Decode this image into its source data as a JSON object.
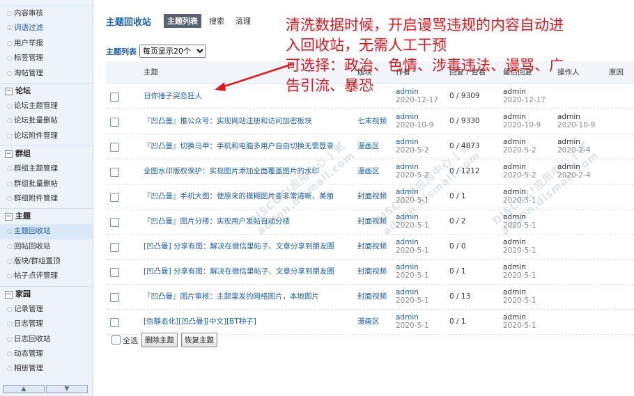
{
  "sidebar": {
    "items_top": [
      {
        "label": "内容审核"
      },
      {
        "label": "词语过滤"
      },
      {
        "label": "用户举报"
      },
      {
        "label": "标签管理"
      },
      {
        "label": "淘帖管理"
      }
    ],
    "groups": [
      {
        "title": "论坛",
        "items": [
          "论坛主题管理",
          "论坛批量删帖",
          "论坛附件管理"
        ]
      },
      {
        "title": "群组",
        "items": [
          "群组主题管理",
          "群组批量删帖",
          "群组附件管理"
        ]
      },
      {
        "title": "主题",
        "items": [
          "主题回收站",
          "回帖回收站",
          "版块/群组置顶",
          "帖子点评管理"
        ]
      },
      {
        "title": "家园",
        "items": [
          "记录管理",
          "日志管理",
          "日志回收站",
          "动态管理",
          "相册管理"
        ]
      }
    ],
    "scroll_up": "▲",
    "scroll_down": "▼"
  },
  "header": {
    "title": "主题回收站",
    "tabs": [
      "主题列表",
      "搜索",
      "清理"
    ]
  },
  "filter": {
    "label": "主题列表",
    "per_page": "每页显示20个"
  },
  "table": {
    "columns": [
      "主题",
      "版块",
      "作者",
      "回复 / 查看",
      "最后回复",
      "操作人",
      "原因"
    ],
    "rows": [
      {
        "subject": "日你捶子突恋狂人",
        "forum": "",
        "author": "admin",
        "author_date": "2020-12-17",
        "replies": "0 / 9309",
        "last": "admin",
        "last_date": "2020-12-17",
        "op": "",
        "op_date": ""
      },
      {
        "subject": "『凹凸曼』推公众号：实现网站注册和访问加密板块",
        "forum": "七末视频",
        "author": "admin",
        "author_date": "2020-10-9",
        "replies": "0 / 9330",
        "last": "admin",
        "last_date": "2020-10-9",
        "op": "admin",
        "op_date": "2020-10-9"
      },
      {
        "subject": "『凹凸曼』切换马甲：手机和电脑多用户自由切换无需登录",
        "forum": "漫画区",
        "author": "admin",
        "author_date": "2020-5-2",
        "replies": "0 / 4873",
        "last": "admin",
        "last_date": "2020-5-2",
        "op": "admin",
        "op_date": "2020-2-4"
      },
      {
        "subject": "全图水印版权保护：实现图片添加全面覆盖图片的水印",
        "forum": "漫画区",
        "author": "admin",
        "author_date": "2020-5-2",
        "replies": "0 / 1212",
        "last": "admin",
        "last_date": "2020-5-2",
        "op": "admin",
        "op_date": "2020-2-4"
      },
      {
        "subject": "『凹凸曼』手机大图：使原来的模糊图片变非常清晰，美丽",
        "forum": "封面视频",
        "author": "admin",
        "author_date": "2020-5-1",
        "replies": "0 / 1",
        "last": "admin",
        "last_date": "2020-5-1",
        "op": "",
        "op_date": ""
      },
      {
        "subject": "『凹凸曼』图片分楼：实现用户发帖自动分楼",
        "forum": "封面视频",
        "author": "admin",
        "author_date": "2020-5-1",
        "replies": "0 / 2",
        "last": "admin",
        "last_date": "2020-5-1",
        "op": "",
        "op_date": ""
      },
      {
        "subject": "[凹凸曼] 分享有图：解决在微信里帖子、文章分享到朋友圈",
        "forum": "封面视频",
        "author": "admin",
        "author_date": "2020-5-1",
        "replies": "0 / 0",
        "last": "admin",
        "last_date": "2020-5-1",
        "op": "",
        "op_date": ""
      },
      {
        "subject": "[凹凸曼] 分享有图：解决在微信里帖子、文章分享到朋友圈",
        "forum": "封面视频",
        "author": "admin",
        "author_date": "2020-5-1",
        "replies": "0 / 1",
        "last": "admin",
        "last_date": "2020-5-1",
        "op": "",
        "op_date": ""
      },
      {
        "subject": "『凹凸曼』图片审核：主题里发的网络图片，本地图片",
        "forum": "封面视频",
        "author": "admin",
        "author_date": "2020-5-1",
        "replies": "0 / 13",
        "last": "admin",
        "last_date": "2020-5-1",
        "op": "",
        "op_date": ""
      },
      {
        "subject": "[伪静态化][凹凸曼][中文][BT种子]",
        "forum": "漫画区",
        "author": "admin",
        "author_date": "2020-5-1",
        "replies": "0 / 1",
        "last": "admin",
        "last_date": "2020-5-1",
        "op": "",
        "op_date": ""
      }
    ]
  },
  "footer": {
    "select_all": "全选",
    "delete_btn": "删除主题",
    "restore_btn": "恢复主题"
  },
  "annotation": {
    "lines": [
      "清洗数据时候，开启谩骂违规的内容自动进",
      "入回收站，无需人工干预",
      "可选择：政治、色情、涉毒违法、谩骂、广",
      "告引流、暴恐"
    ],
    "color": "#e8141b"
  },
  "watermark": {
    "text": "DISCUZ!应用中心 | 贰",
    "sub": "addon.dismall.com"
  }
}
